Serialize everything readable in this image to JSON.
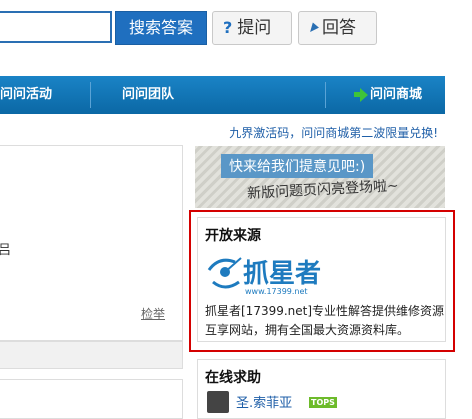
{
  "search": {
    "value": "",
    "button_label": "搜索答案"
  },
  "toolbar": {
    "ask_label": "提问",
    "answer_label": "回答"
  },
  "nav": {
    "items": [
      {
        "label": "问问活动"
      },
      {
        "label": "问问团队"
      },
      {
        "label": "问问商城",
        "icon": "green-arrow-icon"
      }
    ]
  },
  "promo": {
    "text": "九界激活码，问问商城第二波限量兑换!"
  },
  "left": {
    "fragment": "吕",
    "report_label": "检举"
  },
  "banner": {
    "tag": "快来给我们提意见吧:)",
    "handwriting": "新版问题页闪亮登场啦~"
  },
  "open_source": {
    "title": "开放来源",
    "logo_text": "抓星者",
    "logo_url_text": "www.17399.net",
    "description": "抓星者[17399.net]专业性解答提供维修资源互享网站，拥有全国最大资源资料库。"
  },
  "online_help": {
    "title": "在线求助",
    "user": "圣.索菲亚",
    "badge": "TOPS"
  },
  "colors": {
    "nav_blue": "#0c75b6",
    "search_blue": "#1f6fbf",
    "highlight_red": "#d40000",
    "link_blue": "#1f5fa8"
  }
}
